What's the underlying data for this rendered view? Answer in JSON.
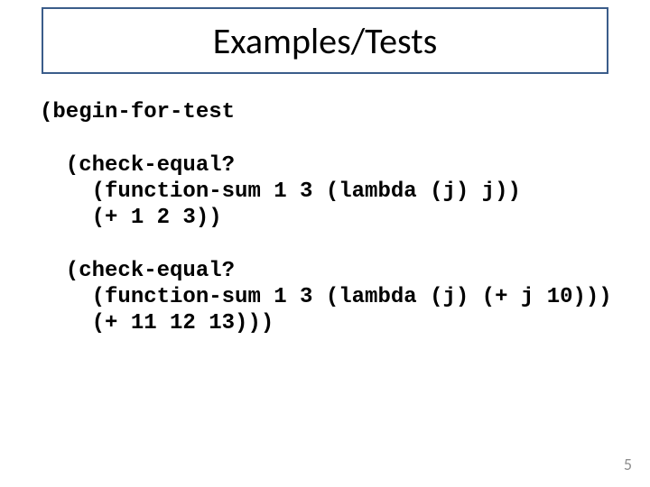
{
  "title": "Examples/Tests",
  "code": "(begin-for-test\n\n  (check-equal?\n    (function-sum 1 3 (lambda (j) j))\n    (+ 1 2 3))\n\n  (check-equal?\n    (function-sum 1 3 (lambda (j) (+ j 10)))\n    (+ 11 12 13)))",
  "page_number": "5"
}
